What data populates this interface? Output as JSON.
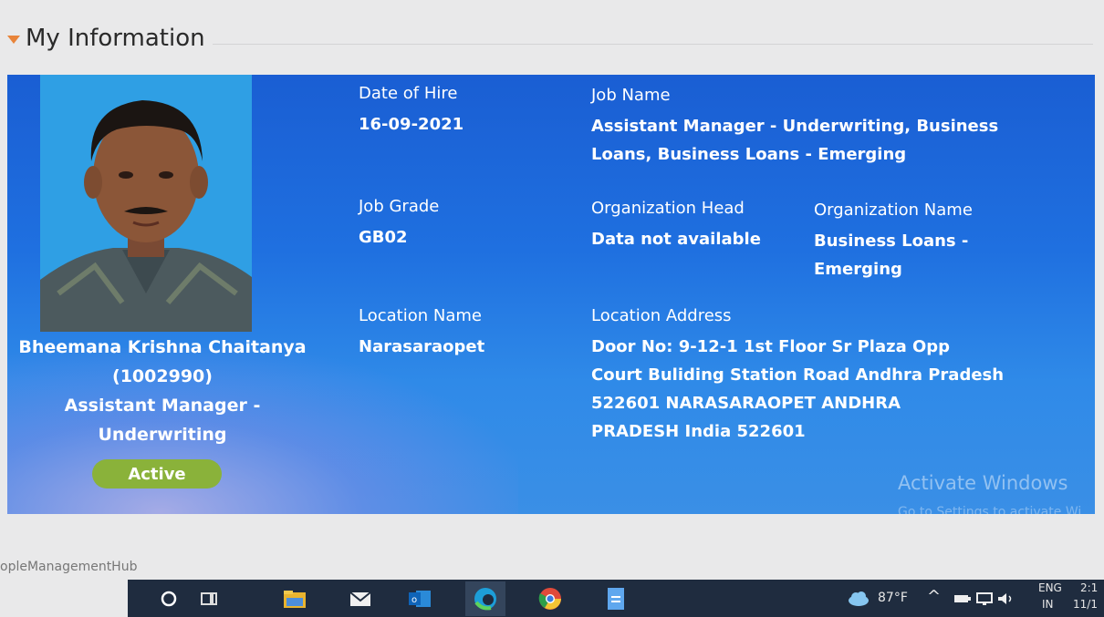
{
  "section": {
    "title": "My Information"
  },
  "employee": {
    "name": "Bheemana Krishna Chaitanya",
    "id": "(1002990)",
    "title_line1": "Assistant Manager -",
    "title_line2": "Underwriting",
    "status": "Active"
  },
  "fields": {
    "date_of_hire": {
      "label": "Date of Hire",
      "value": "16-09-2021"
    },
    "job_name": {
      "label": "Job Name",
      "value_line1": "Assistant Manager - Underwriting, Business",
      "value_line2": "Loans, Business Loans - Emerging"
    },
    "job_grade": {
      "label": "Job Grade",
      "value": "GB02"
    },
    "organization_head": {
      "label": "Organization Head",
      "value": "Data not available"
    },
    "organization_name": {
      "label": "Organization Name",
      "value_line1": "Business Loans -",
      "value_line2": "Emerging"
    },
    "location_name": {
      "label": "Location Name",
      "value": "Narasaraopet"
    },
    "location_address": {
      "label": "Location Address",
      "lines": [
        "Door No: 9-12-1 1st Floor Sr Plaza Opp",
        "Court Buliding Station Road Andhra Pradesh",
        "522601 NARASARAOPET ANDHRA",
        "PRADESH India 522601"
      ]
    }
  },
  "watermark": {
    "title": "Activate Windows",
    "subtitle": "Go to Settings to activate Wi"
  },
  "footer": {
    "hub_label": "opleManagementHub"
  },
  "taskbar": {
    "icons": [
      "search-icon",
      "task-view-icon",
      "file-explorer-icon",
      "mail-icon",
      "outlook-icon",
      "edge-icon",
      "chrome-icon",
      "document-icon"
    ],
    "weather": "87°F",
    "language_top": "ENG",
    "language_bottom": "IN",
    "time_partial": "2:1",
    "date_partial": "11/1"
  },
  "colors": {
    "panel": "#1f6fe0",
    "status_pill": "#8ab23a",
    "accent_triangle": "#e8843a",
    "taskbar": "#1f2c3f"
  }
}
